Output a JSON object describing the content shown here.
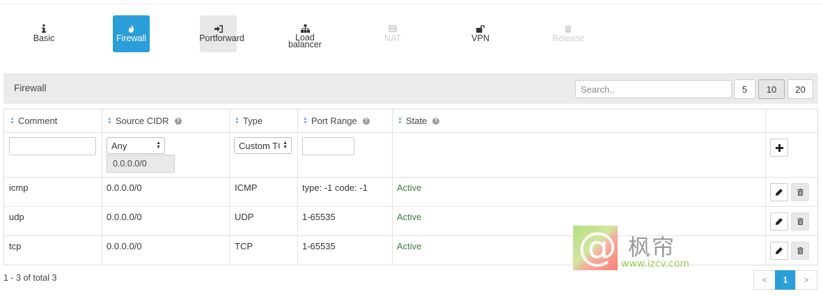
{
  "tabs": [
    {
      "label": "Basic",
      "icon": "info-icon",
      "state": "normal"
    },
    {
      "label": "Firewall",
      "icon": "flame-icon",
      "state": "active"
    },
    {
      "label": "Portforward",
      "icon": "sign-in-icon",
      "state": "hover"
    },
    {
      "label": "Load\nbalancer",
      "icon": "sitemap-icon",
      "state": "normal"
    },
    {
      "label": "NAT",
      "icon": "hdd-icon",
      "state": "disabled"
    },
    {
      "label": "VPN",
      "icon": "unlock-icon",
      "state": "normal"
    },
    {
      "label": "Release",
      "icon": "trash-icon",
      "state": "disabled"
    }
  ],
  "panel": {
    "title": "Firewall",
    "search_placeholder": "Search..",
    "page_sizes": [
      "5",
      "10",
      "20"
    ],
    "selected_page_size": "10"
  },
  "table": {
    "columns": [
      "Comment",
      "Source CIDR",
      "Type",
      "Port Range",
      "State"
    ],
    "new_row": {
      "source_select": "Any",
      "source_cidr": "0.0.0.0/0",
      "type_select": "Custom TC"
    },
    "rows": [
      {
        "comment": "icmp",
        "source_cidr": "0.0.0.0/0",
        "type": "ICMP",
        "port_range": "type: -1 code: -1",
        "state": "Active"
      },
      {
        "comment": "udp",
        "source_cidr": "0.0.0.0/0",
        "type": "UDP",
        "port_range": "1-65535",
        "state": "Active"
      },
      {
        "comment": "tcp",
        "source_cidr": "0.0.0.0/0",
        "type": "TCP",
        "port_range": "1-65535",
        "state": "Active"
      }
    ]
  },
  "footer": {
    "total_text": "1 - 3 of total 3",
    "prev": "<",
    "current_page": "1",
    "next": ">"
  },
  "watermark": {
    "glyph": "@",
    "chinese": "枫帘",
    "url": "www.izcv.com"
  },
  "colors": {
    "accent": "#2a9ed9",
    "active_state": "#3d7a3d"
  }
}
